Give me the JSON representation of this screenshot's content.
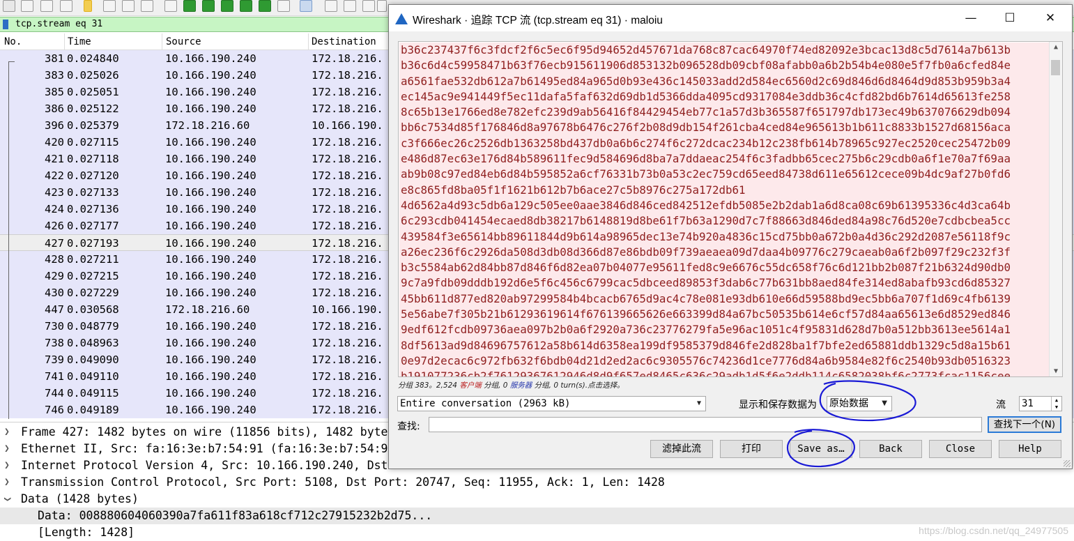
{
  "colors": {
    "annotation": "#1a1ad6",
    "stream_text": "#8f1f1f",
    "stream_bg": "#fde9eb",
    "filter_bg": "#c7f5c4",
    "packet_bg": "#e6e6fa"
  },
  "filter": {
    "text": "tcp.stream eq 31"
  },
  "packet_list": {
    "columns": [
      "No.",
      "Time",
      "Source",
      "Destination"
    ],
    "rows": [
      {
        "no": "381",
        "time": "0.024840",
        "src": "10.166.190.240",
        "dst": "172.18.216."
      },
      {
        "no": "383",
        "time": "0.025026",
        "src": "10.166.190.240",
        "dst": "172.18.216."
      },
      {
        "no": "385",
        "time": "0.025051",
        "src": "10.166.190.240",
        "dst": "172.18.216."
      },
      {
        "no": "386",
        "time": "0.025122",
        "src": "10.166.190.240",
        "dst": "172.18.216."
      },
      {
        "no": "396",
        "time": "0.025379",
        "src": "172.18.216.60",
        "dst": "10.166.190."
      },
      {
        "no": "420",
        "time": "0.027115",
        "src": "10.166.190.240",
        "dst": "172.18.216."
      },
      {
        "no": "421",
        "time": "0.027118",
        "src": "10.166.190.240",
        "dst": "172.18.216."
      },
      {
        "no": "422",
        "time": "0.027120",
        "src": "10.166.190.240",
        "dst": "172.18.216."
      },
      {
        "no": "423",
        "time": "0.027133",
        "src": "10.166.190.240",
        "dst": "172.18.216."
      },
      {
        "no": "424",
        "time": "0.027136",
        "src": "10.166.190.240",
        "dst": "172.18.216."
      },
      {
        "no": "426",
        "time": "0.027177",
        "src": "10.166.190.240",
        "dst": "172.18.216."
      },
      {
        "no": "427",
        "time": "0.027193",
        "src": "10.166.190.240",
        "dst": "172.18.216.",
        "selected": true
      },
      {
        "no": "428",
        "time": "0.027211",
        "src": "10.166.190.240",
        "dst": "172.18.216."
      },
      {
        "no": "429",
        "time": "0.027215",
        "src": "10.166.190.240",
        "dst": "172.18.216."
      },
      {
        "no": "430",
        "time": "0.027229",
        "src": "10.166.190.240",
        "dst": "172.18.216."
      },
      {
        "no": "447",
        "time": "0.030568",
        "src": "172.18.216.60",
        "dst": "10.166.190."
      },
      {
        "no": "730",
        "time": "0.048779",
        "src": "10.166.190.240",
        "dst": "172.18.216."
      },
      {
        "no": "738",
        "time": "0.048963",
        "src": "10.166.190.240",
        "dst": "172.18.216."
      },
      {
        "no": "739",
        "time": "0.049090",
        "src": "10.166.190.240",
        "dst": "172.18.216."
      },
      {
        "no": "741",
        "time": "0.049110",
        "src": "10.166.190.240",
        "dst": "172.18.216."
      },
      {
        "no": "744",
        "time": "0.049115",
        "src": "10.166.190.240",
        "dst": "172.18.216."
      },
      {
        "no": "746",
        "time": "0.049189",
        "src": "10.166.190.240",
        "dst": "172.18.216."
      }
    ]
  },
  "details": {
    "frame": "Frame 427: 1482 bytes on wire (11856 bits), 1482 byte",
    "ethernet": "Ethernet II, Src: fa:16:3e:b7:54:91 (fa:16:3e:b7:54:9",
    "ip": "Internet Protocol Version 4, Src: 10.166.190.240, Dst",
    "tcp": "Transmission Control Protocol, Src Port: 5108, Dst Port: 20747, Seq: 11955, Ack: 1, Len: 1428",
    "data": "Data (1428 bytes)",
    "data_value": "Data: 008880604060390a7fa611f83a618cf712c27915232b2d75...",
    "length": "[Length: 1428]"
  },
  "watermark": "https://blog.csdn.net/qq_24977505",
  "dialog": {
    "title": "Wireshark · 追踪 TCP 流 (tcp.stream eq 31) · maloiu",
    "minimize": "—",
    "maximize": "☐",
    "close": "✕",
    "stream_lines": [
      "b36c237437f6c3fdcf2f6c5ec6f95d94652d457671da768c87cac64970f74ed82092e3bcac13d8c5d7614a7b613b",
      "b36c6d4c59958471b63f76ecb915611906d853132b096528db09cbf08afabb0a6b2b54b4e080e5f7fb0a6cfed84e",
      "a6561fae532db612a7b61495ed84a965d0b93e436c145033add2d584ec6560d2c69d846d6d8464d9d853b959b3a4",
      "ec145ac9e941449f5ec11dafa5faf632d69db1d5366dda4095cd9317084e3ddb36c4cfd82bd6b7614d65613fe258",
      "8c65b13e1766ed8e782efc239d9ab56416f84429454eb77c1a57d3b365587f651797db173ec49b637076629db094",
      "bb6c7534d85f176846d8a97678b6476c276f2b08d9db154f261cba4ced84e965613b1b611c8833b1527d68156aca",
      "c3f666ec26c2526db1363258bd437db0a6b6c274f6c272dcac234b12c238fb614b78965c927ec2520cec25472b09",
      "e486d87ec63e176d84b589611fec9d584696d8ba7a7ddaeac254f6c3fadbb65cec275b6c29cdb0a6f1e70a7f69aa",
      "ab9b08c97ed84eb6d84b595852a6cf76331b73b0a53c2ec759cd65eed84738d611e65612cece09b4dc9af27b0fd6",
      "e8c865fd8ba05f1f1621b612b7b6ace27c5b8976c275a172db61",
      "4d6562a4d93c5db6a129c505ee0aae3846d846ced842512efdb5085e2b2dab1a6d8ca08c69b61395336c4d3ca64b",
      "6c293cdb041454ecaed8db38217b6148819d8be61f7b63a1290d7c7f88663d846ded84a98c76d520e7cdbcbea5cc",
      "439584f3e65614bb89611844d9b614a98965dec13e74b920a4836c15cd75bb0a672b0a4d36c292d2087e56118f9c",
      "a26ec236f6c2926da508d3db08d366d87e86bdb09f739aeaea09d7daa4b09776c279caeab0a6f2b097f29c232f3f",
      "b3c5584ab62d84bb87d846f6d82ea07b04077e95611fed8c9e6676c55dc658f76c6d121bb2b087f21b6324d90db0",
      "9c7a9fdb09dddb192d6e5f6c456c6799cac5dbceed89853f3dab6c77b631bb8aed84fe314ed8abafb93cd6d85327",
      "45bb611d877ed820ab97299584b4bcacb6765d9ac4c78e081e93db610e66d59588bd9ec5bb6a707f1d69c4fb6139",
      "5e56abe7f305b21b61293619614f676139665626e663399d84a67bc50535b614e6cf57d84aa65613e6d8529ed846",
      "9edf612fcdb09736aea097b2b0a6f2920a736c23776279fa5e96ac1051c4f95831d628d7b0a512bb3613ee5614a1",
      "8df5613ad9d84696757612a58b614d6358ea199df9585379d846fe2d828ba1f7bfe2ed65881ddb1329c5d8a15b61",
      "0e97d2ecac6c972fb632f6bdb04d21d2ed2ac6c9305576c74236d1ce7776d84a6b9584e82f6c2540b93db0516323",
      "b191077236cb2f76129367612946d8d9f657ed8465c636c29adb1d5f6e2ddb114c6582038bf6c2773fcac1156cee"
    ],
    "stats": {
      "prefix": "分组 383。2,524 ",
      "client": "客户端",
      "middle1": " 分组, 0 ",
      "server": "服务器",
      "suffix": " 分组, 0 turn(s).点击选择。"
    },
    "conversation": "Entire conversation (2963 kB)",
    "show_save_label": "显示和保存数据为",
    "format": "原始数据",
    "stream_label": "流",
    "stream_number": "31",
    "find_label": "查找:",
    "find_value": "",
    "find_next": "查找下一个(N)",
    "buttons": {
      "filter_out": "滤掉此流",
      "print": "打印",
      "save_as": "Save as…",
      "back": "Back",
      "close": "Close",
      "help": "Help"
    }
  }
}
